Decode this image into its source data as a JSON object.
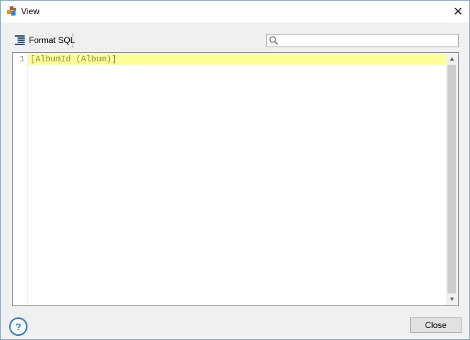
{
  "window": {
    "title": "View",
    "app_icon": "app-icon",
    "close_icon": "close-icon"
  },
  "toolbar": {
    "format_label": "Format SQL",
    "format_icon": "format-sql-icon",
    "search_icon": "search-icon",
    "search_value": "",
    "search_placeholder": ""
  },
  "editor": {
    "lines": [
      {
        "number": "1",
        "text": "[AlbumId (Album)]"
      }
    ],
    "highlight_color": "#ffff99",
    "text_color": "#9a8a48"
  },
  "footer": {
    "help_label": "?",
    "close_label": "Close"
  },
  "colors": {
    "accent": "#1e7ad2",
    "window_border": "#7ba7d1"
  }
}
